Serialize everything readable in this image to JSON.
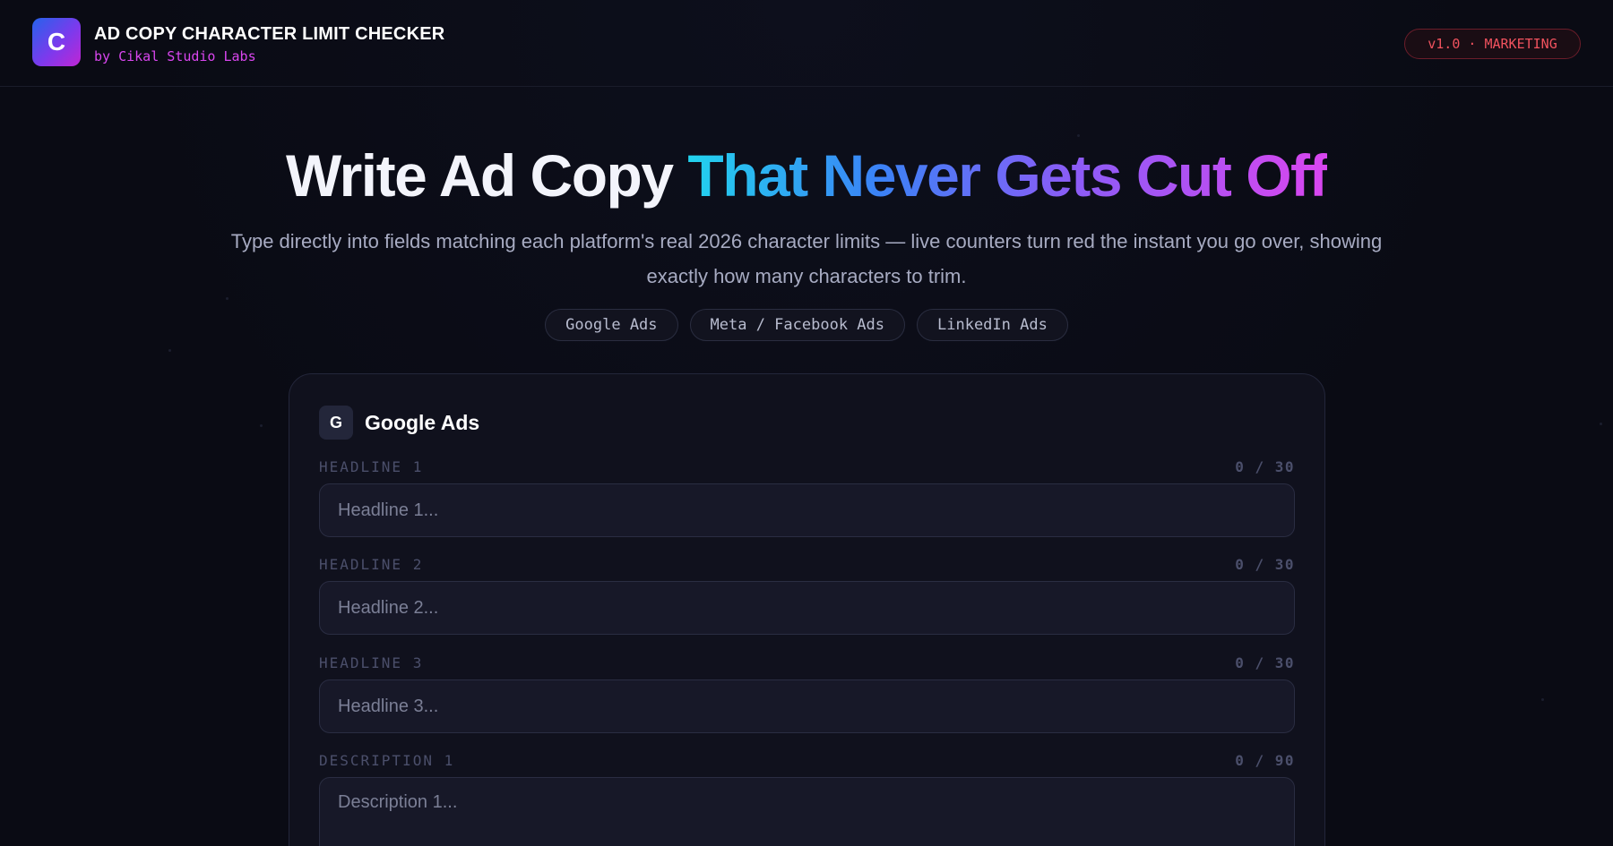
{
  "header": {
    "logo_letter": "C",
    "title": "AD COPY CHARACTER LIMIT CHECKER",
    "subtitle": "by Cikal Studio Labs",
    "badge": "v1.0 · MARKETING"
  },
  "hero": {
    "title_plain": "Write Ad Copy",
    "title_accent": "That Never Gets Cut Off",
    "subtitle": "Type directly into fields matching each platform's real 2026 character limits — live counters turn red the instant you go over, showing exactly how many characters to trim.",
    "platform_chips": [
      {
        "label": "Google Ads"
      },
      {
        "label": "Meta / Facebook Ads"
      },
      {
        "label": "LinkedIn Ads"
      }
    ]
  },
  "card": {
    "icon_letter": "G",
    "title": "Google Ads",
    "fields": [
      {
        "label": "HEADLINE 1",
        "counter": "0 / 30",
        "placeholder": "Headline 1...",
        "value": ""
      },
      {
        "label": "HEADLINE 2",
        "counter": "0 / 30",
        "placeholder": "Headline 2...",
        "value": ""
      },
      {
        "label": "HEADLINE 3",
        "counter": "0 / 30",
        "placeholder": "Headline 3...",
        "value": ""
      },
      {
        "label": "DESCRIPTION 1",
        "counter": "0 / 90",
        "placeholder": "Description 1...",
        "value": ""
      }
    ]
  },
  "colors": {
    "background": "#0a0b14",
    "accent_magenta": "#d946ef",
    "accent_cyan": "#22d3ee",
    "accent_blue": "#3b82f6",
    "badge_red": "#f0525e"
  }
}
